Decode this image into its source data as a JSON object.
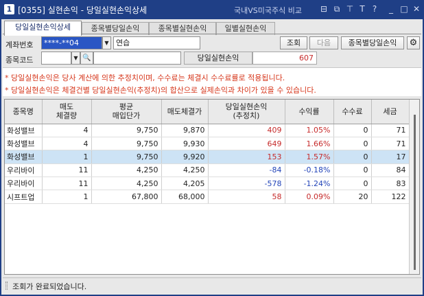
{
  "window": {
    "number": "1",
    "title": "[0355] 실현손익 - 당일실현손익상세",
    "compare_label": "국내VS미국주식 비교",
    "buttons": [
      "⊟",
      "⧉",
      "⊤",
      "T",
      "?",
      "_",
      "□",
      "✕"
    ]
  },
  "tabs": [
    "당일실현손익상세",
    "종목별당일손익",
    "종목별실현손익",
    "일별실현손익"
  ],
  "form": {
    "account_label": "계좌번호",
    "account_value": "****-**04",
    "account_name": "연습",
    "query_button": "조회",
    "next_button": "다음",
    "stock_daily_button": "종목별당일손익",
    "code_label": "종목코드",
    "code_value": "",
    "search_icon": "🔍",
    "code_name": "",
    "realized_label": "당일실현손익",
    "realized_value": "607"
  },
  "notices": [
    "* 당일실현손익은 당사 계산에 의한 추정치이며, 수수료는 체결시 수수료률로 적용됩니다.",
    "* 당일실현손익은 체결건별 당일실현손익(추정치)의 합산으로 실제손익과 차이가 있을 수 있습니다."
  ],
  "table": {
    "headers": [
      "종목명",
      "매도\n체결량",
      "평균\n매입단가",
      "매도체결가",
      "당일실현손익\n(추정치)",
      "수익률",
      "수수료",
      "세금"
    ],
    "rows": [
      {
        "name": "화성밸브",
        "qty": "4",
        "avg": "9,750",
        "sell": "9,870",
        "pnl": "409",
        "rate": "1.05%",
        "fee": "0",
        "tax": "71",
        "sign": "pos"
      },
      {
        "name": "화성밸브",
        "qty": "4",
        "avg": "9,750",
        "sell": "9,930",
        "pnl": "649",
        "rate": "1.66%",
        "fee": "0",
        "tax": "71",
        "sign": "pos"
      },
      {
        "name": "화성밸브",
        "qty": "1",
        "avg": "9,750",
        "sell": "9,920",
        "pnl": "153",
        "rate": "1.57%",
        "fee": "0",
        "tax": "17",
        "sign": "pos"
      },
      {
        "name": "우리바이",
        "qty": "11",
        "avg": "4,250",
        "sell": "4,250",
        "pnl": "-84",
        "rate": "-0.18%",
        "fee": "0",
        "tax": "84",
        "sign": "neg"
      },
      {
        "name": "우리바이",
        "qty": "11",
        "avg": "4,250",
        "sell": "4,205",
        "pnl": "-578",
        "rate": "-1.24%",
        "fee": "0",
        "tax": "83",
        "sign": "neg"
      },
      {
        "name": "시프트업",
        "qty": "1",
        "avg": "67,800",
        "sell": "68,000",
        "pnl": "58",
        "rate": "0.09%",
        "fee": "20",
        "tax": "122",
        "sign": "pos"
      }
    ],
    "selected_row": 2
  },
  "status": "조회가 완료되었습니다."
}
